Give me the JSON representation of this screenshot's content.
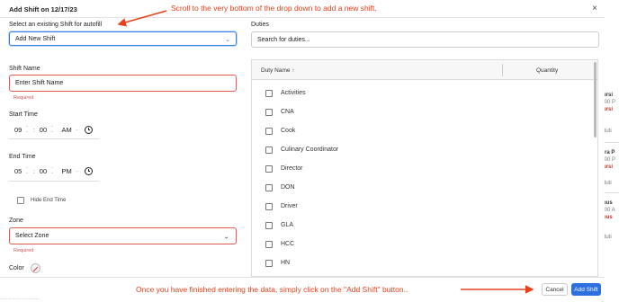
{
  "modal": {
    "title": "Add Shift on 12/17/23",
    "close": "×"
  },
  "autofill": {
    "label": "Select an existing Shift for autofill",
    "value": "Add New Shift"
  },
  "duties_search": {
    "label": "Duties",
    "placeholder": "Search for duties..."
  },
  "shift_name": {
    "label": "Shift Name",
    "placeholder": "Enter Shift Name",
    "required": "Required"
  },
  "start_time": {
    "label": "Start Time",
    "hour": "09",
    "minute": "00",
    "ampm": "AM"
  },
  "end_time": {
    "label": "End Time",
    "hour": "05",
    "minute": "00",
    "ampm": "PM"
  },
  "hide_end_time": {
    "label": "Hide End Time"
  },
  "zone": {
    "label": "Zone",
    "value": "Select Zone",
    "required": "Required"
  },
  "color": {
    "label": "Color"
  },
  "duties_table": {
    "col_name": "Duty Name",
    "sort_icon": "↑",
    "col_qty": "Quantity",
    "rows": [
      "Activities",
      "CNA",
      "Cook",
      "Culinary Coordinator",
      "Director",
      "DON",
      "Driver",
      "GLA",
      "HCC",
      "HN"
    ]
  },
  "footer": {
    "cancel": "Cancel",
    "add": "Add Shift"
  },
  "annotations": {
    "top": "Scroll to the very bottom of the drop down to add a new shift.",
    "bottom": "Once you have finished entering the data, simply click on the \"Add Shift\" button.."
  },
  "background": {
    "items": [
      {
        "b": "ursi",
        "g": ":00 P",
        "o": "ursi"
      },
      {
        "g": "duti"
      },
      {
        "b": "tra P",
        "g": ":00 P",
        "o": "ursi"
      },
      {
        "g": "duti"
      },
      {
        "b": "ous",
        "g": ":00 A",
        "o": "ous"
      },
      {
        "g": "duti"
      }
    ]
  },
  "colors": {
    "accent": "#2d6fe0",
    "error": "#e05a5a",
    "annotation": "#e8401c"
  }
}
